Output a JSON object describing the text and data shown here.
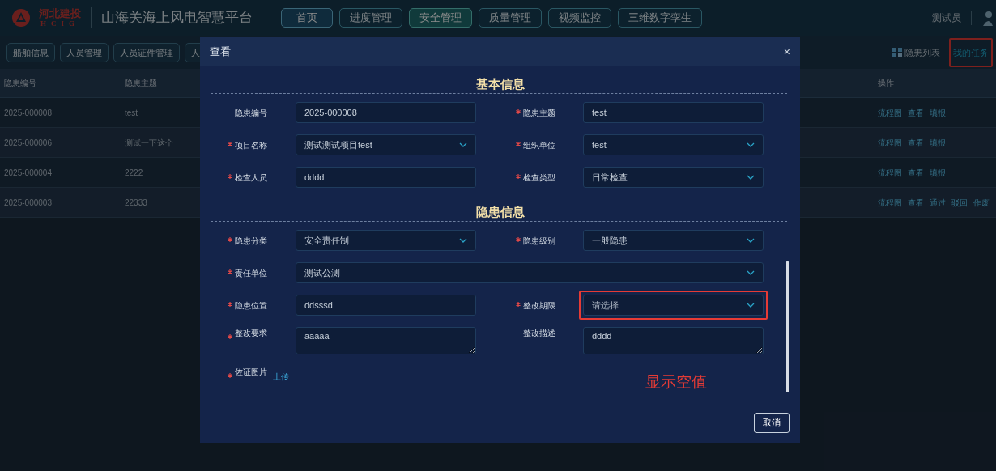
{
  "header": {
    "logo_text": "河北建投",
    "logo_subtext": "HCIG",
    "title": "山海关海上风电智慧平台",
    "nav": [
      {
        "label": "首页",
        "selected": false
      },
      {
        "label": "进度管理",
        "selected": false
      },
      {
        "label": "安全管理",
        "selected": true
      },
      {
        "label": "质量管理",
        "selected": false
      },
      {
        "label": "视频监控",
        "selected": false
      },
      {
        "label": "三维数字孪生",
        "selected": false
      }
    ],
    "user": "测试员"
  },
  "subnav": {
    "tabs": [
      {
        "label": "船舶信息"
      },
      {
        "label": "人员管理"
      },
      {
        "label": "人员证件管理"
      },
      {
        "label": "人"
      }
    ],
    "links": [
      {
        "label": "隐患列表",
        "selected": false,
        "highlighted": false
      },
      {
        "label": "我的任务",
        "selected": true,
        "highlighted": true
      }
    ]
  },
  "table": {
    "columns": [
      "隐患编号",
      "隐患主题",
      "操作"
    ],
    "rows": [
      {
        "id": "2025-000008",
        "subject": "test",
        "actions": [
          "流程图",
          "查看",
          "填报"
        ]
      },
      {
        "id": "2025-000006",
        "subject": "测试一下这个",
        "actions": [
          "流程图",
          "查看",
          "填报"
        ]
      },
      {
        "id": "2025-000004",
        "subject": "2222",
        "actions": [
          "流程图",
          "查看",
          "填报"
        ]
      },
      {
        "id": "2025-000003",
        "subject": "22333",
        "actions": [
          "流程图",
          "查看",
          "通过",
          "驳回",
          "作废"
        ]
      }
    ]
  },
  "dialog": {
    "title": "查看",
    "close": "×",
    "sections": [
      {
        "title": "基本信息",
        "rows": [
          [
            {
              "label": "隐患编号",
              "required": false,
              "kind": "input",
              "value": "2025-000008"
            },
            {
              "label": "隐患主题",
              "required": true,
              "kind": "input",
              "value": "test"
            }
          ],
          [
            {
              "label": "项目名称",
              "required": true,
              "kind": "select",
              "value": "测试测试项目test"
            },
            {
              "label": "组织单位",
              "required": true,
              "kind": "select",
              "value": "test"
            }
          ],
          [
            {
              "label": "检查人员",
              "required": true,
              "kind": "input",
              "value": "dddd"
            },
            {
              "label": "检查类型",
              "required": true,
              "kind": "select",
              "value": "日常检查"
            }
          ]
        ]
      },
      {
        "title": "隐患信息",
        "rows": [
          [
            {
              "label": "隐患分类",
              "required": true,
              "kind": "select",
              "value": "安全责任制"
            },
            {
              "label": "隐患级别",
              "required": true,
              "kind": "select",
              "value": "一般隐患"
            }
          ],
          [
            {
              "label": "责任单位",
              "required": true,
              "kind": "select",
              "value": "测试公测",
              "wide": true
            }
          ],
          [
            {
              "label": "隐患位置",
              "required": true,
              "kind": "input",
              "value": "ddsssd"
            },
            {
              "label": "整改期限",
              "required": true,
              "kind": "select",
              "placeholder": "请选择",
              "highlighted": true
            }
          ],
          [
            {
              "label": "整改要求",
              "required": true,
              "kind": "textarea",
              "value": "aaaaa"
            },
            {
              "label": "整改描述",
              "required": false,
              "kind": "textarea",
              "value": "dddd"
            }
          ],
          [
            {
              "label": "佐证图片",
              "required": true,
              "kind": "upload",
              "value": "上传"
            }
          ]
        ]
      }
    ],
    "annotation": "显示空值",
    "buttons": [
      "取消"
    ]
  }
}
